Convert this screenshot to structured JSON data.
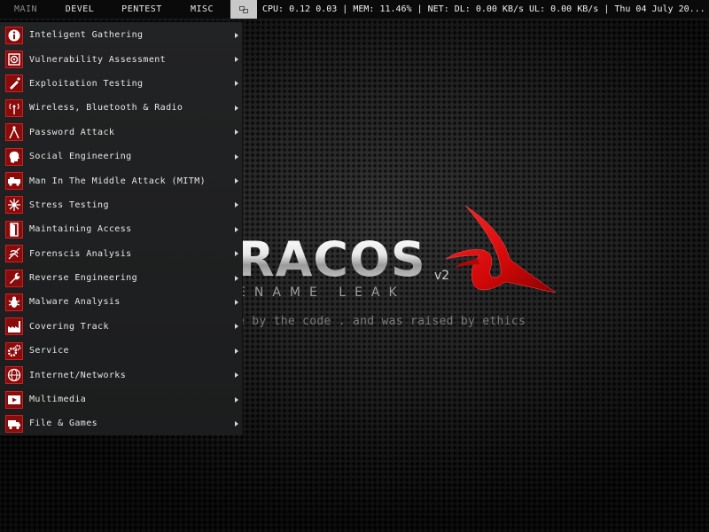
{
  "topbar": {
    "workspaces": [
      "MAIN",
      "DEVEL",
      "PENTEST",
      "MISC"
    ],
    "status": "CPU: 0.12 0.03 | MEM: 11.46% | NET: DL: 0.00 KB/s UL: 0.00 KB/s | Thu 04 July 20..."
  },
  "menu": {
    "items": [
      {
        "label": "Inteligent Gathering",
        "icon": "info-icon"
      },
      {
        "label": "Vulnerability Assessment",
        "icon": "target-icon"
      },
      {
        "label": "Exploitation Testing",
        "icon": "syringe-icon"
      },
      {
        "label": "Wireless, Bluetooth & Radio",
        "icon": "antenna-icon"
      },
      {
        "label": "Password Attack",
        "icon": "compass-icon"
      },
      {
        "label": "Social Engineering",
        "icon": "head-icon"
      },
      {
        "label": "Man In The Middle Attack (MITM)",
        "icon": "vehicle-icon"
      },
      {
        "label": "Stress Testing",
        "icon": "burst-icon"
      },
      {
        "label": "Maintaining Access",
        "icon": "door-icon"
      },
      {
        "label": "Forenscis Analysis",
        "icon": "fingerprint-icon"
      },
      {
        "label": "Reverse Engineering",
        "icon": "wrench-icon"
      },
      {
        "label": "Malware Analysis",
        "icon": "bug-icon"
      },
      {
        "label": "Covering Track",
        "icon": "factory-icon"
      },
      {
        "label": "Service",
        "icon": "gears-icon"
      },
      {
        "label": "Internet/Networks",
        "icon": "globe-icon"
      },
      {
        "label": "Multimedia",
        "icon": "media-icon"
      },
      {
        "label": "File & Games",
        "icon": "truck-icon"
      }
    ]
  },
  "wallpaper": {
    "logo_text": "RACOS",
    "version": "v2",
    "subtitle": "ENAME LEAK",
    "tagline": "e by the code . and was raised by ethics"
  },
  "colors": {
    "accent": "#8b0a0a",
    "logo_red": "#e01010",
    "menu_bg": "#202122",
    "bar_bg": "#0a0a0a"
  }
}
